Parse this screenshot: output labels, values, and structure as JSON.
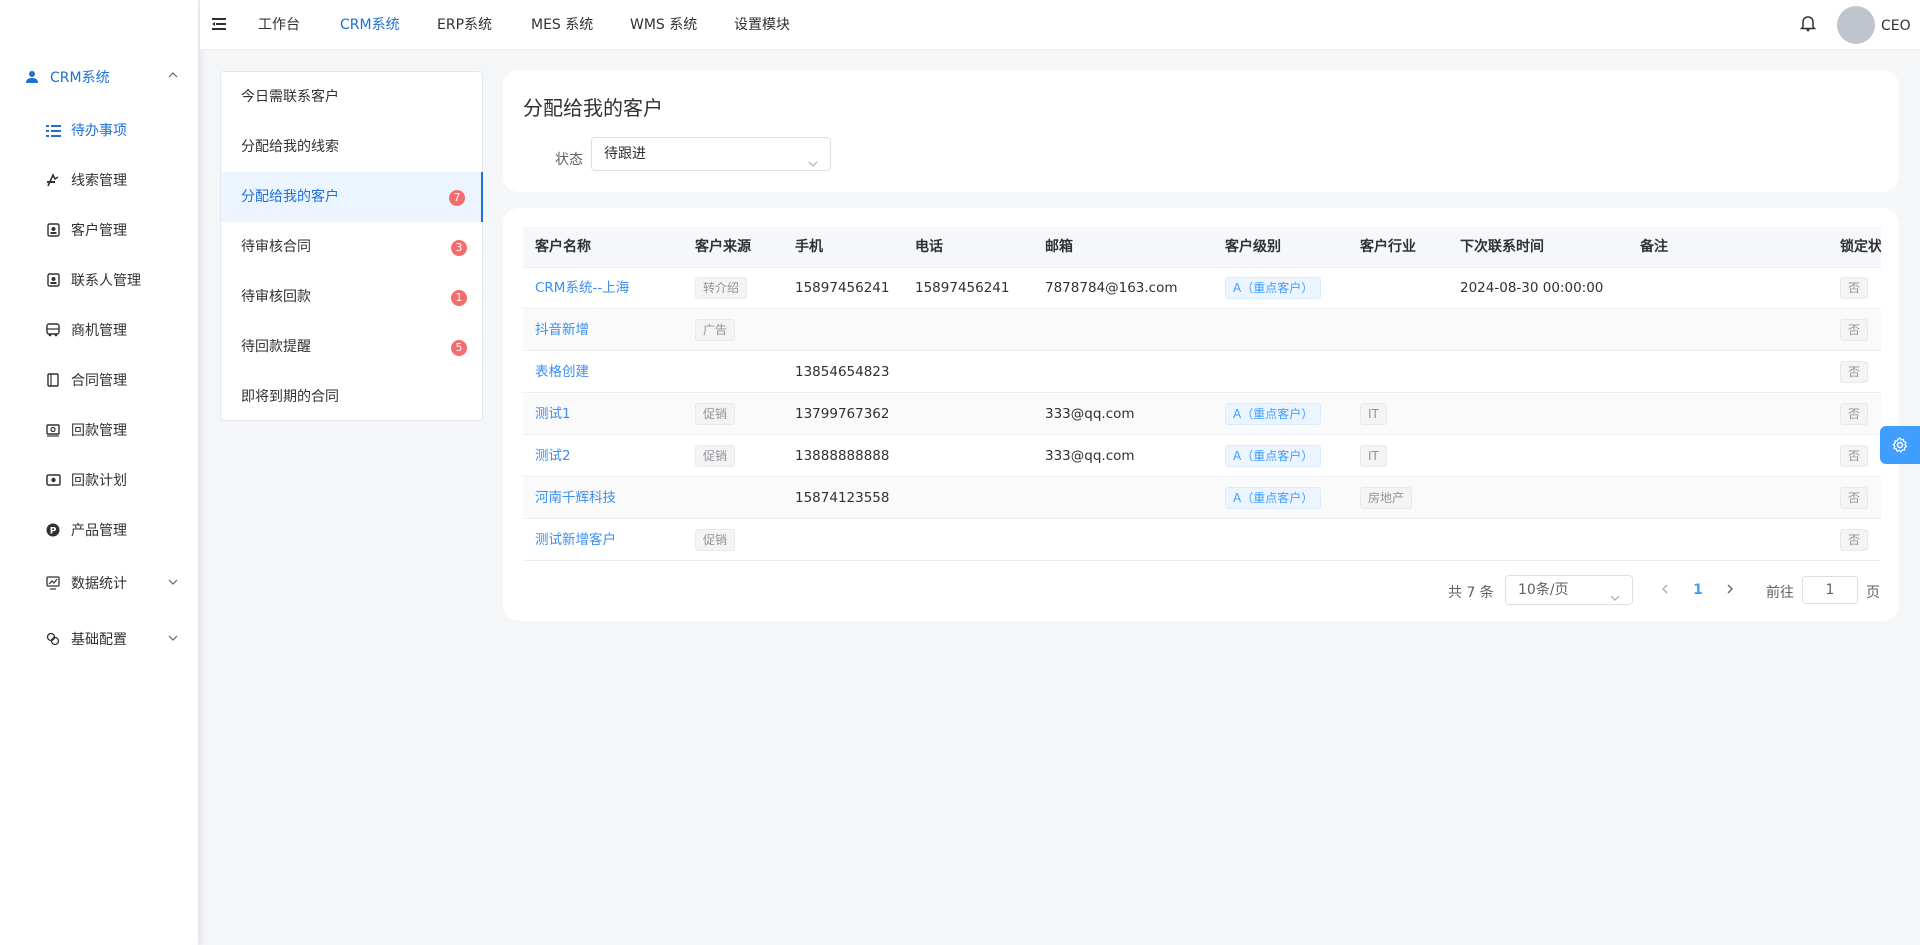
{
  "sidebar": {
    "group": "CRM系统",
    "items": [
      {
        "label": "待办事项",
        "icon": "list-check-icon",
        "active": true
      },
      {
        "label": "线索管理",
        "icon": "lead-icon"
      },
      {
        "label": "客户管理",
        "icon": "contact-card-icon"
      },
      {
        "label": "联系人管理",
        "icon": "contact-card-icon"
      },
      {
        "label": "商机管理",
        "icon": "bus-icon"
      },
      {
        "label": "合同管理",
        "icon": "document-icon"
      },
      {
        "label": "回款管理",
        "icon": "payment-icon"
      },
      {
        "label": "回款计划",
        "icon": "money-icon"
      },
      {
        "label": "产品管理",
        "icon": "product-p-icon"
      },
      {
        "label": "数据统计",
        "icon": "chart-icon"
      },
      {
        "label": "基础配置",
        "icon": "config-icon"
      }
    ]
  },
  "topnav": {
    "items": [
      "工作台",
      "CRM系统",
      "ERP系统",
      "MES 系统",
      "WMS 系统",
      "设置模块"
    ],
    "active": "CRM系统",
    "user": "CEO"
  },
  "submenu": {
    "items": [
      {
        "label": "今日需联系客户",
        "badge": ""
      },
      {
        "label": "分配给我的线索",
        "badge": ""
      },
      {
        "label": "分配给我的客户",
        "badge": "7",
        "active": true
      },
      {
        "label": "待审核合同",
        "badge": "3"
      },
      {
        "label": "待审核回款",
        "badge": "1"
      },
      {
        "label": "待回款提醒",
        "badge": "5"
      },
      {
        "label": "即将到期的合同",
        "badge": ""
      }
    ]
  },
  "filter": {
    "title": "分配给我的客户",
    "status_label": "状态",
    "status_value": "待跟进"
  },
  "table": {
    "headers": [
      "客户名称",
      "客户来源",
      "手机",
      "电话",
      "邮箱",
      "客户级别",
      "客户行业",
      "下次联系时间",
      "备注",
      "锁定状"
    ],
    "rows": [
      {
        "name": "CRM系统--上海",
        "source": "转介绍",
        "mobile": "15897456241",
        "phone": "15897456241",
        "email": "7878784@163.com",
        "level": "A（重点客户）",
        "industry": "",
        "next": "2024-08-30 00:00:00",
        "remark": "",
        "locked": "否"
      },
      {
        "name": "抖音新增",
        "source": "广告",
        "mobile": "",
        "phone": "",
        "email": "",
        "level": "",
        "industry": "",
        "next": "",
        "remark": "",
        "locked": "否"
      },
      {
        "name": "表格创建",
        "source": "",
        "mobile": "13854654823",
        "phone": "",
        "email": "",
        "level": "",
        "industry": "",
        "next": "",
        "remark": "",
        "locked": "否"
      },
      {
        "name": "测试1",
        "source": "促销",
        "mobile": "13799767362",
        "phone": "",
        "email": "333@qq.com",
        "level": "A（重点客户）",
        "industry": "IT",
        "next": "",
        "remark": "",
        "locked": "否"
      },
      {
        "name": "测试2",
        "source": "促销",
        "mobile": "13888888888",
        "phone": "",
        "email": "333@qq.com",
        "level": "A（重点客户）",
        "industry": "IT",
        "next": "",
        "remark": "",
        "locked": "否"
      },
      {
        "name": "河南千辉科技",
        "source": "",
        "mobile": "15874123558",
        "phone": "",
        "email": "",
        "level": "A（重点客户）",
        "industry": "房地产",
        "next": "",
        "remark": "",
        "locked": "否"
      },
      {
        "name": "测试新增客户",
        "source": "促销",
        "mobile": "",
        "phone": "",
        "email": "",
        "level": "",
        "industry": "",
        "next": "",
        "remark": "",
        "locked": "否"
      }
    ]
  },
  "pagination": {
    "total": "共 7 条",
    "page_size": "10条/页",
    "current": "1",
    "goto_label": "前往",
    "goto_value": "1",
    "page_suffix": "页"
  },
  "colors": {
    "accent": "#1f6fd6",
    "link": "#3b8ff0",
    "badge": "#f56c6c"
  }
}
